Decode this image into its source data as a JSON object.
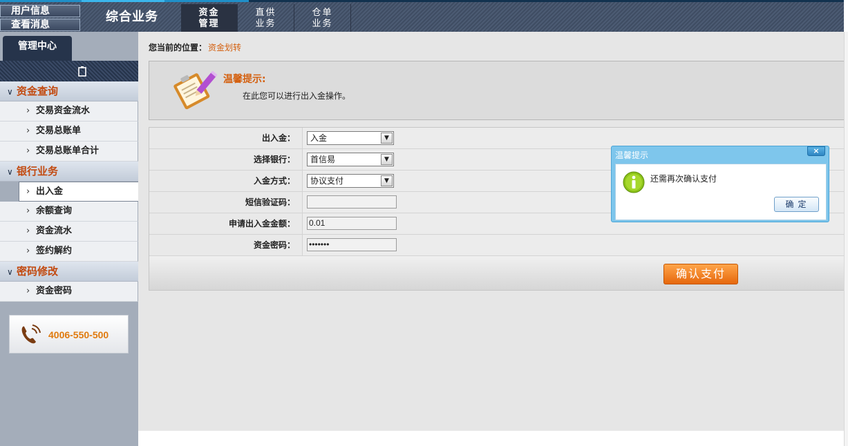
{
  "header": {
    "user_info": "用户信息",
    "view_messages": "查看消息",
    "brand": "综合业务",
    "tabs": [
      {
        "line1": "资金",
        "line2": "管理"
      },
      {
        "line1": "直供",
        "line2": "业务"
      },
      {
        "line1": "仓单",
        "line2": "业务"
      }
    ]
  },
  "sidebar": {
    "tab": "管理中心",
    "groups": [
      {
        "label": "资金查询",
        "items": [
          "交易资金流水",
          "交易总账单",
          "交易总账单合计"
        ]
      },
      {
        "label": "银行业务",
        "items": [
          "出入金",
          "余额查询",
          "资金流水",
          "签约解约"
        ]
      },
      {
        "label": "密码修改",
        "items": [
          "资金密码"
        ]
      }
    ],
    "active_item": "出入金",
    "phone": "4006-550-500"
  },
  "breadcrumb": {
    "prefix": "您当前的位置：",
    "current": "资金划转"
  },
  "tip": {
    "title": "温馨提示:",
    "text": "在此您可以进行出入金操作。"
  },
  "form": {
    "rows": [
      {
        "label": "出入金：",
        "type": "select",
        "value": "入金"
      },
      {
        "label": "选择银行：",
        "type": "select",
        "value": "首信易"
      },
      {
        "label": "入金方式：",
        "type": "select",
        "value": "协议支付"
      },
      {
        "label": "短信验证码：",
        "type": "input",
        "value": ""
      },
      {
        "label": "申请出入金金额：",
        "type": "input",
        "value": "0.01"
      },
      {
        "label": "资金密码：",
        "type": "password",
        "value": "•••••••"
      }
    ],
    "submit": "确认支付"
  },
  "dialog": {
    "title": "温馨提示",
    "close": "×",
    "message": "还需再次确认支付",
    "ok": "确定"
  },
  "colors": {
    "accent_orange": "#e6680d",
    "dialog_blue": "#7ec6ec",
    "nav_dark": "#26344b"
  }
}
